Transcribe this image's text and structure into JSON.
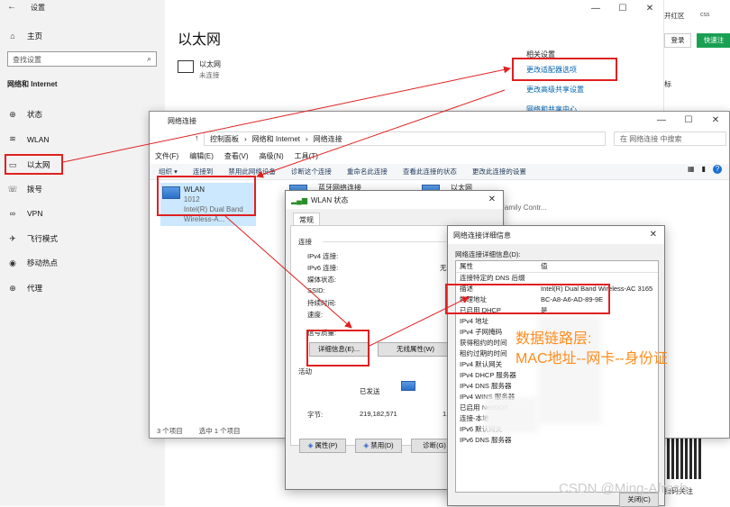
{
  "settings": {
    "window_title": "设置",
    "home": "主页",
    "search_placeholder": "查找设置",
    "section": "网络和 Internet",
    "nav": [
      "状态",
      "WLAN",
      "以太网",
      "拨号",
      "VPN",
      "飞行模式",
      "移动热点",
      "代理"
    ],
    "nav_icons": [
      "home-icon",
      "wifi-icon",
      "ethernet-icon",
      "dialup-icon",
      "vpn-icon",
      "airplane-icon",
      "hotspot-icon",
      "globe-icon"
    ],
    "page_title": "以太网",
    "ethernet_name": "以太网",
    "ethernet_status": "未连接",
    "related_title": "相关设置",
    "related_links": [
      "更改适配器选项",
      "更改高级共享设置",
      "网络和共享中心"
    ]
  },
  "browser": {
    "tab_text": "开红区",
    "tab_chip": "css",
    "login": "登录",
    "quick": "快速注",
    "side_text": "标"
  },
  "netwin": {
    "title": "网络连接",
    "breadcrumb": [
      "控制面板",
      "网络和 Internet",
      "网络连接"
    ],
    "search_placeholder": "在 网络连接 中搜索",
    "menu": [
      "文件(F)",
      "编辑(E)",
      "查看(V)",
      "高级(N)",
      "工具(T)"
    ],
    "commands": [
      "组织 ▾",
      "连接到",
      "禁用此网络设备",
      "诊断这个连接",
      "重命名此连接",
      "查看此连接的状态",
      "更改此连接的设置"
    ],
    "adapters": [
      {
        "name": "WLAN",
        "line2": "1012",
        "line3": "Intel(R) Dual Band Wireless-A..."
      },
      {
        "name": "蓝牙网络连接",
        "line2": "",
        "line3": ""
      },
      {
        "name": "以太网",
        "line2": "",
        "line3": "Family Contr..."
      }
    ],
    "status_count": "3 个项目",
    "status_selected": "选中 1 个项目"
  },
  "wlan_status": {
    "title": "WLAN 状态",
    "tab": "常规",
    "section_conn": "连接",
    "fields": [
      "IPv4 连接:",
      "IPv6 连接:",
      "媒体状态:",
      "SSID:",
      "持续时间:",
      "速度:",
      "信号质量:"
    ],
    "ipv6_value": "无网",
    "btn_details": "详细信息(E)...",
    "btn_wireless": "无线属性(W)",
    "section_activity": "活动",
    "sent_label": "已发送",
    "bytes_label": "字节:",
    "bytes_sent": "219,182,571",
    "bytes_recv": "1,",
    "btn_properties": "属性(P)",
    "btn_disable": "禁用(D)",
    "btn_diagnose": "诊断(G)"
  },
  "details": {
    "title": "网络连接详细信息",
    "label": "网络连接详细信息(D):",
    "col_property": "属性",
    "col_value": "值",
    "rows": [
      [
        "连接特定的 DNS 后缀",
        ""
      ],
      [
        "描述",
        "Intel(R) Dual Band Wireless-AC 3165"
      ],
      [
        "物理地址",
        "BC-A8-A6-AD-89-9E"
      ],
      [
        "已启用 DHCP",
        "是"
      ],
      [
        "IPv4 地址",
        ""
      ],
      [
        "IPv4 子网掩码",
        ""
      ],
      [
        "获得租约的时间",
        ""
      ],
      [
        "租约过期的时间",
        ""
      ],
      [
        "IPv4 默认网关",
        ""
      ],
      [
        "IPv4 DHCP 服务器",
        ""
      ],
      [
        "IPv4 DNS 服务器",
        ""
      ],
      [
        "IPv4 WINS 服务器",
        ""
      ],
      [
        "已启用 NetBIOS",
        ""
      ],
      [
        "连接-本地",
        ""
      ],
      [
        "IPv6 默认网关",
        ""
      ],
      [
        "IPv6 DNS 服务器",
        ""
      ]
    ],
    "close_btn": "关闭(C)"
  },
  "annotation": {
    "line1": "数据链路层:",
    "line2": "MAC地址--网卡--身份证"
  },
  "watermark": "CSDN @Ming-Afresh",
  "qr_caption": "扫码关注",
  "colors": {
    "red": "#e02020",
    "link": "#0063b1",
    "note": "#ff8c1a"
  }
}
